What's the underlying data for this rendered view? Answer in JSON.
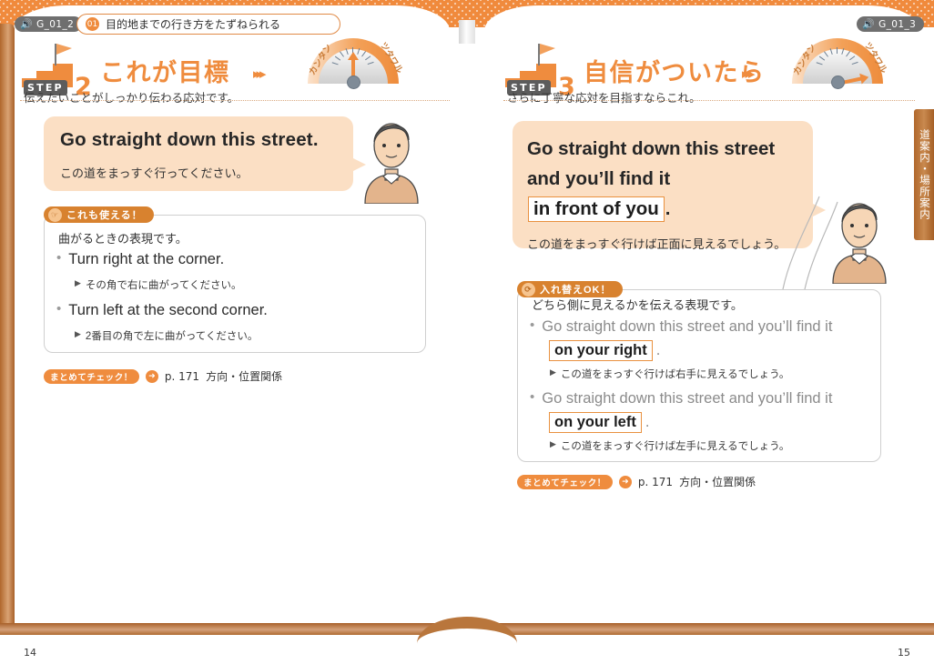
{
  "header": {
    "audio_left": "G_01_2",
    "audio_right": "G_01_3",
    "speaker_icon": "speaker-icon",
    "lesson_number": "01",
    "lesson_title": "目的地までの行き方をたずねられる"
  },
  "side_tab": {
    "label": "道案内・場所案内"
  },
  "page_numbers": {
    "left": "14",
    "right": "15"
  },
  "steps": [
    {
      "badge_word": "STEP",
      "number": "2",
      "title": "これが目標",
      "subtitle": "伝えたいことがしっかり伝わる応対です。",
      "arrows": "▸▸▸",
      "gauge": {
        "label_left": "カンタン",
        "label_right": "ツタワル",
        "needle_angle_deg": 0
      },
      "bubble": {
        "english": "Go straight down this street.",
        "japanese": "この道をまっすぐ行ってください。"
      },
      "info_box": {
        "tab_label": "これも使える！",
        "tab_icon": "pointing-hand-icon",
        "intro": "曲がるときの表現です。",
        "items": [
          {
            "english": "Turn right at the corner.",
            "japanese": "その角で右に曲がってください。"
          },
          {
            "english": "Turn left at the second corner.",
            "japanese": "2番目の角で左に曲がってください。"
          }
        ]
      },
      "check": {
        "pill_label": "まとめてチェック！",
        "arrow_icon": "arrow-right-circle-icon",
        "page": "p. 171",
        "topic": "方向・位置関係"
      }
    },
    {
      "badge_word": "STEP",
      "number": "3",
      "title": "自信がついたら",
      "subtitle": "さらに丁寧な応対を目指すならこれ。",
      "arrows": "▸▸▸",
      "gauge": {
        "label_left": "カンタン",
        "label_right": "ツタワル",
        "needle_angle_deg": 78
      },
      "bubble": {
        "english_parts": [
          {
            "text": "Go straight down this street and you’ll find it ",
            "highlight": false
          },
          {
            "text": "in front of you",
            "highlight": true
          },
          {
            "text": ".",
            "highlight": false
          }
        ],
        "japanese": "この道をまっすぐ行けば正面に見えるでしょう。"
      },
      "info_box": {
        "tab_label": "入れ替えOK！",
        "tab_icon": "swap-arrows-icon",
        "intro": "どちら側に見えるかを伝える表現です。",
        "items": [
          {
            "english_prefix": "Go straight down this street and you’ll find it",
            "highlight": "on your right",
            "suffix": ".",
            "japanese": "この道をまっすぐ行けば右手に見えるでしょう。"
          },
          {
            "english_prefix": "Go straight down this street and you’ll find it",
            "highlight": "on your left",
            "suffix": ".",
            "japanese": "この道をまっすぐ行けば左手に見えるでしょう。"
          }
        ]
      },
      "check": {
        "pill_label": "まとめてチェック！",
        "arrow_icon": "arrow-right-circle-icon",
        "page": "p. 171",
        "topic": "方向・位置関係"
      }
    }
  ],
  "colors": {
    "accent_orange": "#ef8c3e",
    "bubble_fill": "#fbdfc4",
    "book_brown": "#b0672c",
    "tab_brown": "#d8822f",
    "gray_text": "#8b8b8b"
  },
  "bullet_symbol": "•",
  "triangle_symbol": "▶"
}
